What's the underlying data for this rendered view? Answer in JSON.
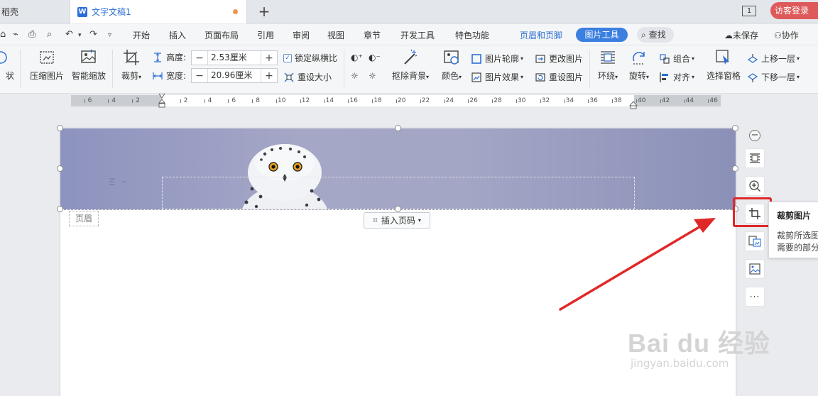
{
  "tabs": {
    "prev_label": "稻壳",
    "active_icon": "W",
    "active_label": "文字文稿1",
    "new_tab": "+"
  },
  "window": {
    "count": "1",
    "login_label": "访客登录"
  },
  "menu": {
    "items": [
      "开始",
      "插入",
      "页面布局",
      "引用",
      "审阅",
      "视图",
      "章节",
      "开发工具",
      "特色功能"
    ],
    "header_footer": "页眉和页脚",
    "picture_tools": "图片工具",
    "search": "查找",
    "unsaved": "未保存",
    "collab": "协作"
  },
  "ribbon": {
    "shape_label": "状",
    "compress": "压缩图片",
    "smart_zoom": "智能缩放",
    "crop": "裁剪",
    "height_label": "高度:",
    "height_value": "2.53厘米",
    "width_label": "宽度:",
    "width_value": "20.96厘米",
    "lock_ratio": "锁定纵横比",
    "reset_size": "重设大小",
    "remove_bg": "抠除背景",
    "color": "颜色",
    "outline": "图片轮廓",
    "effect": "图片效果",
    "change_pic": "更改图片",
    "reset_pic": "重设图片",
    "wrap": "环绕",
    "rotate": "旋转",
    "group": "组合",
    "align": "对齐",
    "selection_pane": "选择窗格",
    "bring_forward": "上移一层",
    "send_backward": "下移一层"
  },
  "ruler": {
    "left_ticks": [
      "6",
      "4",
      "2"
    ],
    "right_ticks": [
      "2",
      "4",
      "6",
      "8",
      "10",
      "12",
      "14",
      "16",
      "18",
      "20",
      "22",
      "24",
      "26",
      "28",
      "30",
      "32",
      "34",
      "36",
      "38",
      "40",
      "42",
      "44",
      "46"
    ]
  },
  "document": {
    "header_label": "页眉",
    "insert_page_number": "插入页码"
  },
  "tooltip": {
    "title": "裁剪图片",
    "desc_line1": "裁剪所选图",
    "desc_line2": "需要的部分"
  },
  "side_toolbar": {
    "more": "···"
  },
  "watermark": {
    "brand": "Bai du 经验",
    "url": "jingyan.baidu.com"
  },
  "colors": {
    "accent": "#3b7fe0",
    "highlight_box": "#e02828",
    "arrow": "#e02828",
    "login": "#de5a5a"
  }
}
